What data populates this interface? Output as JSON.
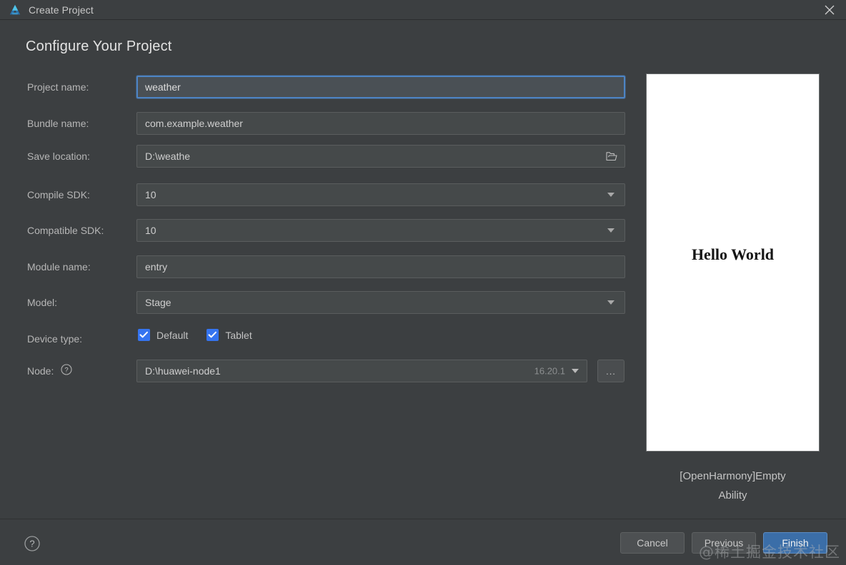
{
  "titlebar": {
    "title": "Create Project",
    "logo_icon": "deveco-logo-icon",
    "close_icon": "close-icon",
    "logo_color_light": "#4FC3E8",
    "logo_color_dark": "#2A6FA8"
  },
  "page": {
    "heading": "Configure Your Project"
  },
  "form": {
    "rows": [
      {
        "label": "Project name:",
        "value": "weather",
        "type": "text",
        "focused": true
      },
      {
        "label": "Bundle name:",
        "value": "com.example.weather",
        "type": "text",
        "focused": false
      },
      {
        "label": "Save location:",
        "value": "D:\\weathe",
        "type": "path",
        "focused": false,
        "icon": "folder-open-icon"
      },
      {
        "label": "Compile SDK:",
        "value": "10",
        "type": "dropdown",
        "focused": false,
        "icon": "chevron-down-icon"
      },
      {
        "label": "Compatible SDK:",
        "value": "10",
        "type": "dropdown",
        "focused": false,
        "icon": "chevron-down-icon"
      },
      {
        "label": "Module name:",
        "value": "entry",
        "type": "text",
        "focused": false
      },
      {
        "label": "Model:",
        "value": "Stage",
        "type": "dropdown",
        "focused": false,
        "icon": "chevron-down-icon"
      }
    ],
    "device_type": {
      "label": "Device type:",
      "options": [
        {
          "label": "Default",
          "checked": true
        },
        {
          "label": "Tablet",
          "checked": true
        }
      ],
      "checkbox_color": "#3574f0"
    },
    "node": {
      "label": "Node:",
      "help_icon": "help-circle-icon",
      "value": "D:\\huawei-node1",
      "version": "16.20.1",
      "caret_icon": "chevron-down-icon",
      "browse_label": "...",
      "browse_icon": "ellipsis-icon"
    }
  },
  "preview": {
    "screen_text": "Hello World",
    "caption_line1": "[OpenHarmony]Empty",
    "caption_line2": "Ability"
  },
  "footer": {
    "help_icon": "help-circle-icon",
    "buttons": [
      {
        "label": "Cancel",
        "primary": false
      },
      {
        "label": "Previous",
        "primary": false
      },
      {
        "label": "Finish",
        "primary": true
      }
    ],
    "primary_color": "#3b6ea8"
  },
  "watermark": {
    "text": "@稀土掘金技术社区"
  }
}
